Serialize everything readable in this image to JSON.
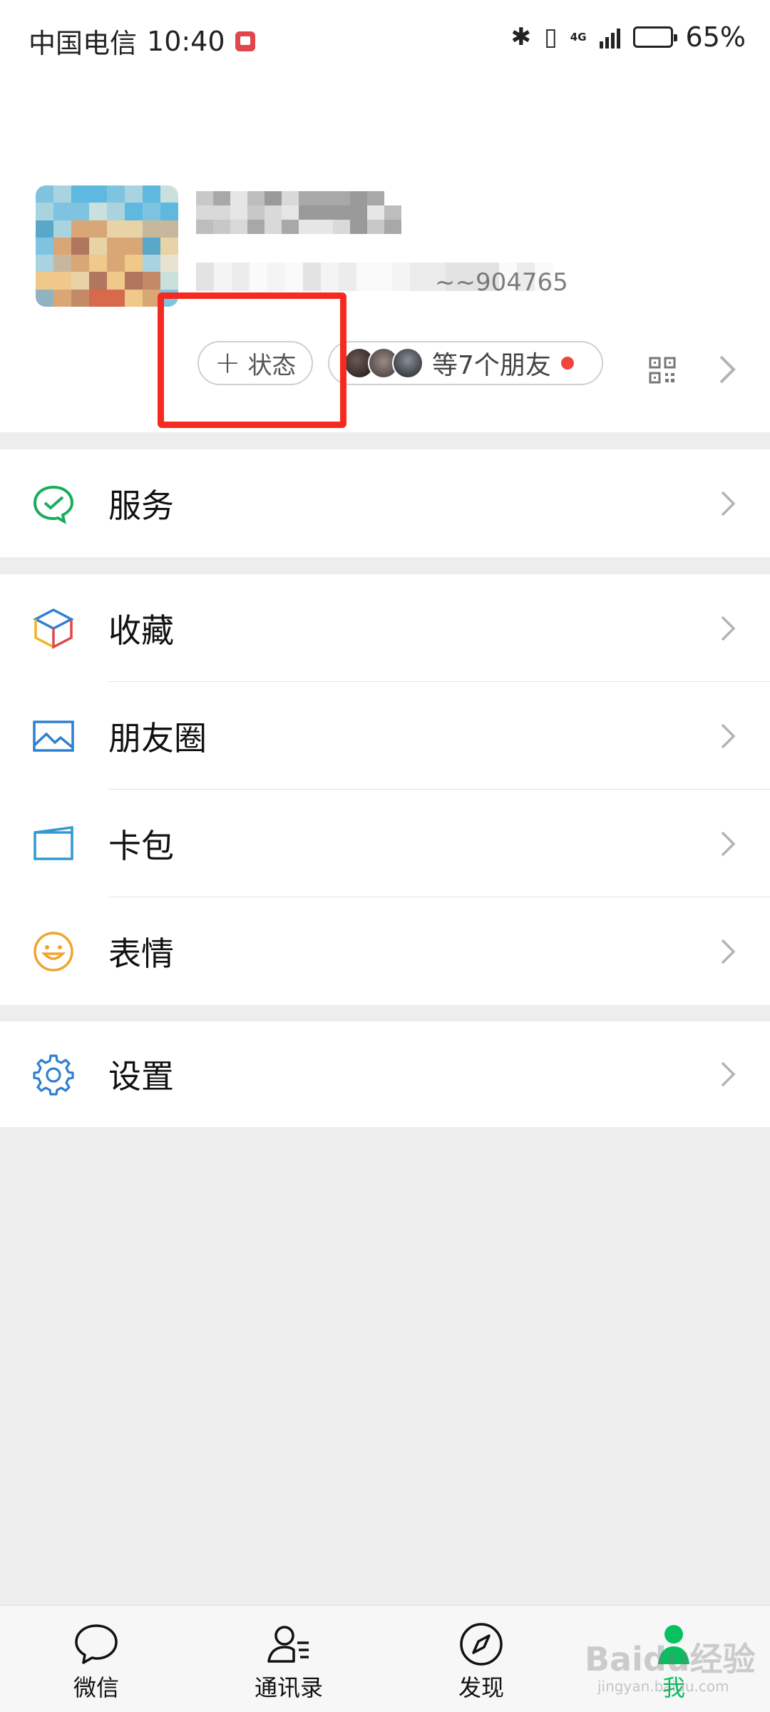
{
  "status_bar": {
    "carrier": "中国电信",
    "time": "10:40",
    "network": "4G",
    "battery_percent": "65%",
    "battery_level": 0.65
  },
  "profile": {
    "id_fragment": "~~904765",
    "status_button_label": "状态",
    "friends_label": "等7个朋友",
    "friend_avatar_count": 3
  },
  "menu": {
    "services": "服务",
    "favorites": "收藏",
    "moments": "朋友圈",
    "card_wallet": "卡包",
    "stickers": "表情",
    "settings": "设置"
  },
  "tabs": {
    "chats": "微信",
    "contacts": "通讯录",
    "discover": "发现",
    "me": "我",
    "active": "me"
  },
  "colors": {
    "accent": "#07c160",
    "highlight": "#f52a20",
    "red_dot": "#f0443d"
  },
  "watermark": {
    "brand": "Baidu经验",
    "url": "jingyan.baidu.com"
  }
}
